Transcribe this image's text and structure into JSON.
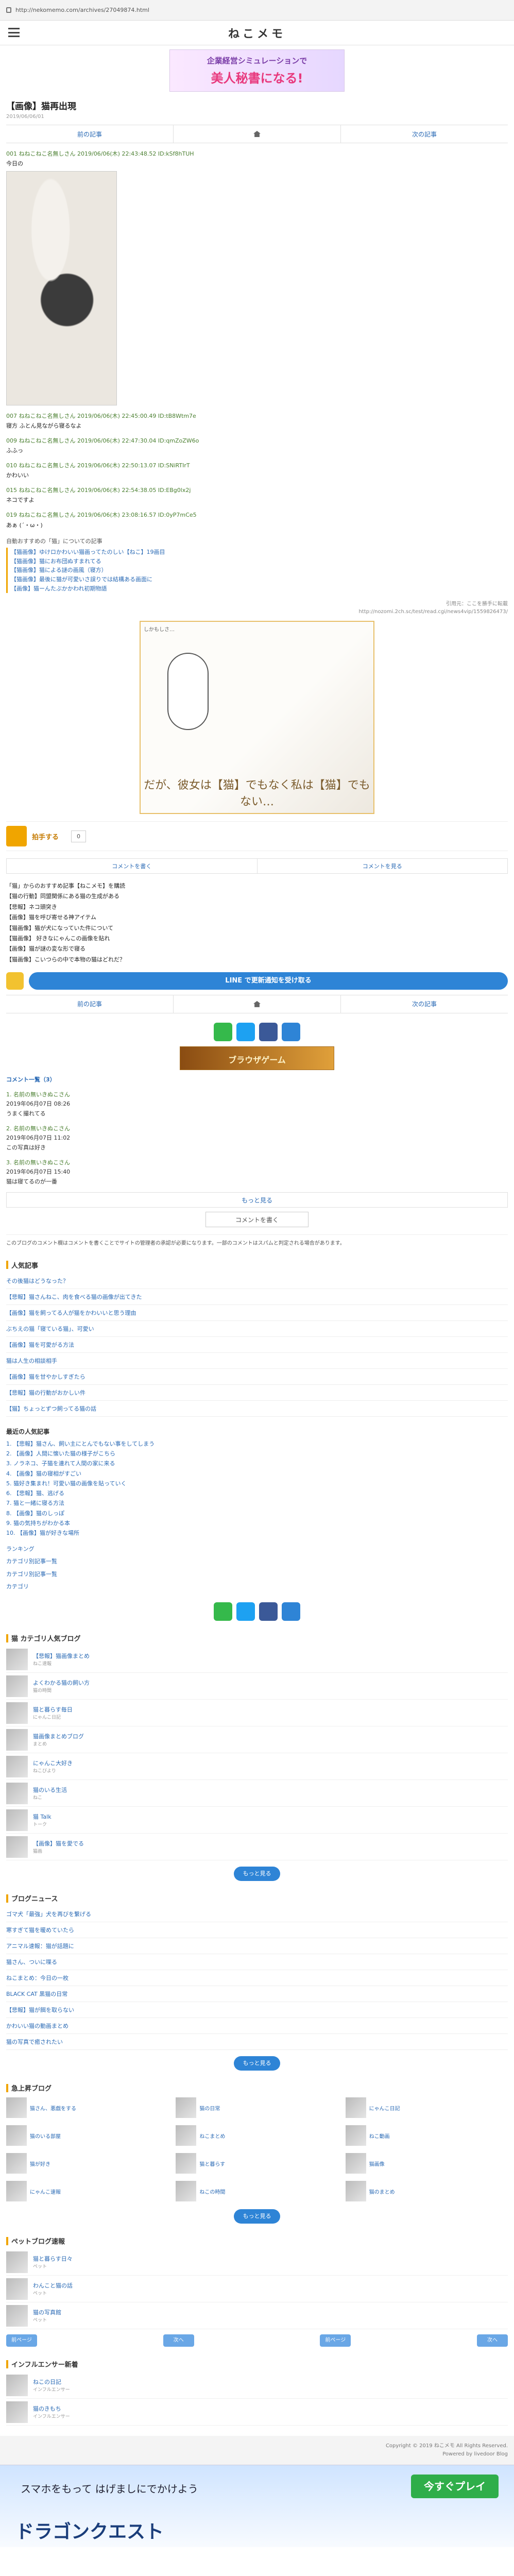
{
  "url": "http://nekomemo.com/archives/27049874.html",
  "site": {
    "logo": "ねこメモ"
  },
  "banners": {
    "top": {
      "line1": "企業経営シミュレーションで",
      "line2": "美人秘書になる!"
    },
    "mid": {
      "line1": "企業経営シミュレーションで",
      "line2": "美人秘書"
    },
    "bottom": {
      "line2": "ブラウザゲーム"
    }
  },
  "entry": {
    "title": "【画像】猫再出現",
    "date": "2019/06/06/01"
  },
  "nav": {
    "prev": "前の記事",
    "next": "次の記事"
  },
  "posts": [
    {
      "header": "001 ねねこねこ名無しさん 2019/06/06(木) 22:43:48.52 ID:kSf8hTUH",
      "body": "今日の"
    },
    {
      "header": "007 ねねこねこ名無しさん 2019/06/06(木) 22:45:00.49 ID:tB8Wtm7e",
      "body": "寝方 ふとん見ながら寝るなよ"
    },
    {
      "header": "009 ねねこねこ名無しさん 2019/06/06(木) 22:47:30.04 ID:qmZoZW6o",
      "body": "ふふっ"
    },
    {
      "header": "010 ねねこねこ名無しさん 2019/06/06(木) 22:50:13.07 ID:SNiRTIrT",
      "body": "かわいい"
    },
    {
      "header": "015 ねねこねこ名無しさん 2019/06/06(木) 22:54:38.05 ID:EBg0lx2j",
      "body": "ネコですよ"
    },
    {
      "header": "019 ねねこねこ名無しさん 2019/06/06(木) 23:08:16.57 ID:0yP7mCe5",
      "body": "あぁ (´・ω・)"
    }
  ],
  "related_box": {
    "title": "自動おすすめの「猫」についての記事",
    "links": [
      "【猫画像】ゆけロかわいい猫画ってたのしい【ねこ】19画目",
      "【猫画像】猫にお布団ぬすまれてる",
      "【猫画像】猫による謎の画風（寝方）",
      "【猫画像】最後に猫が可愛いさ誤りでは結構ある画面に",
      "【画像】猫ーんたぶかかわれ初期物語"
    ]
  },
  "source": {
    "line1": "引用元：ここを勝手に転載",
    "line2": "http://nozomi.2ch.sc/test/read.cgi/news4vip/1559826473/"
  },
  "manga": {
    "tag": "しかもしさ…",
    "bottom": "だが、彼女は【猫】でもなく私は【猫】でもない…"
  },
  "like": {
    "label": "拍手する",
    "count": "0"
  },
  "commentbar": {
    "a": "コメントを書く",
    "b": "コメントを見る"
  },
  "related_list": [
    "「猫」からのおすすめ記事【ねこメモ】を購読",
    "【猫の行動】同盟関係にある猫の生成がある",
    "【悲報】ネコ頭突き",
    "【画像】猫を呼び寄せる神アイテム",
    "【猫画像】猫が犬になっていた件について",
    "【猫画像】 好きなにゃんこの画像を貼れ",
    "【画像】猫が謎の変な形で寝る",
    "【猫画像】こいつらの中で本物の猫はどれだ？"
  ],
  "download": {
    "label": "LINE で更新通知を受け取る"
  },
  "comments": {
    "heading": "コメント一覧（3）",
    "items": [
      {
        "name": "1. 名前の無いきぬこさん",
        "date": "2019年06月07日 08:26",
        "body": "うまく撮れてる"
      },
      {
        "name": "2. 名前の無いきぬこさん",
        "date": "2019年06月07日 11:02",
        "body": "この写真は好き"
      },
      {
        "name": "3. 名前の無いきぬこさん",
        "date": "2019年06月07日 15:40",
        "body": "猫は寝てるのが一番"
      }
    ],
    "more": "もっと見る",
    "post": "コメントを書く"
  },
  "notice": "このブログのコメント欄はコメントを書くことでサイトの管理者の承認が必要になります。一部のコメントはスパムと判定される場合があります。",
  "popular": {
    "title": "人気記事",
    "items": [
      "その後猫はどうなった？",
      "【悲報】猫さんねこ、肉を食べる猫の画像が出てきた",
      "【画像】猫を飼ってる人が猫をかわいいと思う理由",
      "ぶちえの猫「寝ている猫」、可愛い",
      "【画像】猫を可愛がる方法",
      "猫は人生の相談相手",
      "【画像】猫を甘やかしすぎたら",
      "【悲報】猫の行動がおかしい件",
      "【猫】ちょっとずつ飼ってる猫の話"
    ]
  },
  "ranking": {
    "title": "最近の人気記事",
    "items": [
      "1. 【悲報】猫さん、飼い主にとんでもない事をしてしまう",
      "2. 【画像】人間に懐いた猫の様子がこちら",
      "3. ノラネコ、子猫を連れて人間の家に来る",
      "4. 【画像】猫の寝相がすごい",
      "5. 猫好き集まれ！可愛い猫の画像を貼っていく",
      "6. 【悲報】猫、逃げる",
      "7. 猫と一緒に寝る方法",
      "8. 【画像】猫のしっぽ",
      "9. 猫の気持ちがわかる本",
      "10. 【画像】猫が好きな場所"
    ]
  },
  "plain_links": [
    "ランキング",
    "カテゴリ別記事一覧",
    "カテゴリ別記事一覧",
    "カテゴリ"
  ],
  "blogs_section": {
    "title": "猫 カテゴリ人気ブログ",
    "items": [
      {
        "title": "【悲報】猫画像まとめ",
        "sub": "ねこ速報"
      },
      {
        "title": "よくわかる猫の飼い方",
        "sub": "猫の時間"
      },
      {
        "title": "猫と暮らす毎日",
        "sub": "にゃんこ日記"
      },
      {
        "title": "猫画像まとめブログ",
        "sub": "まとめ"
      },
      {
        "title": "にゃんこ大好き",
        "sub": "ねこびより"
      },
      {
        "title": "猫のいる生活",
        "sub": "ねこ"
      },
      {
        "title": "猫 Talk",
        "sub": "トーク"
      },
      {
        "title": "【画像】猫を愛でる",
        "sub": "猫画"
      }
    ],
    "more": "もっと見る"
  },
  "programs": {
    "title": "ブログニュース",
    "items": [
      "ゴマ犬「最強」犬を再びを繋げる",
      "寒すぎて猫を暖めていたら",
      "アニマル速報：猫が話題に",
      "猫さん、ついに喋る",
      "ねこまとめ：今日の一枚",
      "BLACK CAT 黒猫の日常",
      "【悲報】猫が餌を取らない",
      "かわいい猫の動画まとめ",
      "猫の写真で癒されたい"
    ],
    "more": "もっと見る"
  },
  "grid_section": {
    "title": "急上昇ブログ",
    "items": [
      "猫さん、悪戯をする",
      "猫の日常",
      "にゃんこ日記",
      "猫のいる部屋",
      "ねこまとめ",
      "ねこ動画",
      "猫が好き",
      "猫と暮らす",
      "猫画像",
      "にゃんこ速報",
      "ねこの時間",
      "猫のまとめ"
    ],
    "more": "もっと見る"
  },
  "pet_blogs": {
    "title": "ペットブログ速報",
    "items": [
      {
        "title": "猫と暮らす日々",
        "sub": "ペット"
      },
      {
        "title": "わんこと猫の話",
        "sub": "ペット"
      },
      {
        "title": "猫の写真館",
        "sub": "ペット"
      }
    ],
    "nav": [
      "前ページ",
      "次へ",
      "前ページ",
      "次へ"
    ]
  },
  "influencer": {
    "title": "インフルエンサー新着",
    "items": [
      {
        "title": "ねこの日記",
        "sub": "インフルエンサー"
      },
      {
        "title": "猫のきもち",
        "sub": "インフルエンサー"
      }
    ]
  },
  "footer": {
    "line1": "Copyright © 2019 ねこメモ All Rights Reserved.",
    "line2": "Powered by livedoor Blog"
  },
  "ad_bottom": {
    "line1": "スマホをもって はげましにでかけよう",
    "line2": "ドラゴンクエスト",
    "play": "今すぐプレイ"
  },
  "colors": {
    "accent": "#f0a500",
    "link": "#2a6ab5",
    "button": "#2e84d6"
  }
}
